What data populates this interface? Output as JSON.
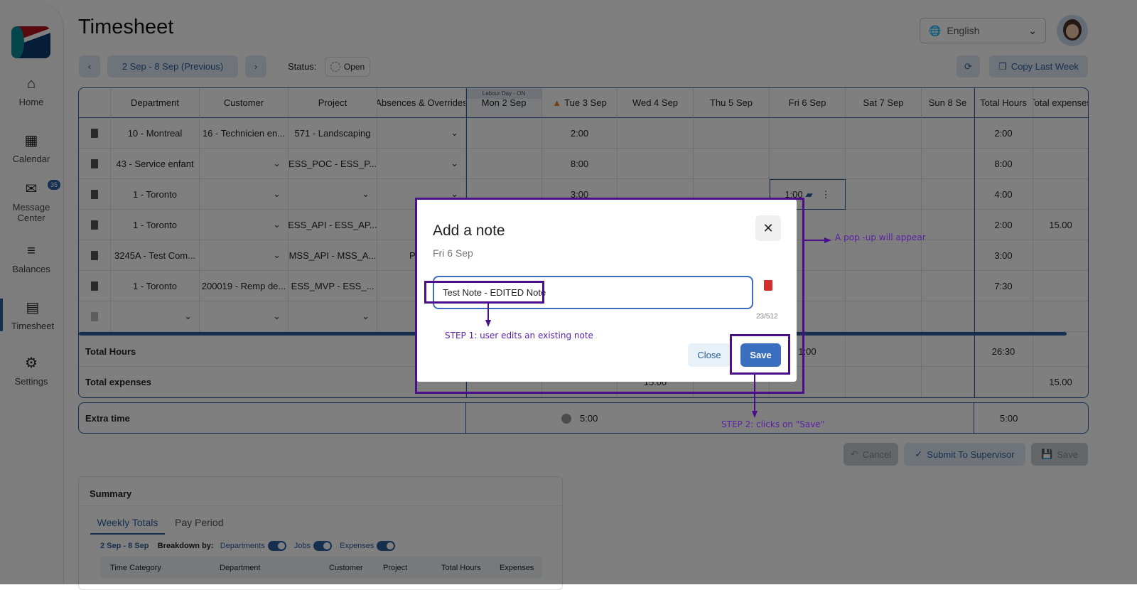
{
  "page_title": "Timesheet",
  "sidebar": {
    "items": [
      {
        "label": "Home",
        "icon": "home-icon",
        "glyph": "⌂"
      },
      {
        "label": "Calendar",
        "icon": "calendar-icon",
        "glyph": "▦"
      },
      {
        "label": "Message Center",
        "icon": "message-icon",
        "glyph": "✉",
        "badge": "35"
      },
      {
        "label": "Balances",
        "icon": "balances-icon",
        "glyph": "≡"
      },
      {
        "label": "Timesheet",
        "icon": "timesheet-icon",
        "glyph": "▤",
        "active": true
      },
      {
        "label": "Settings",
        "icon": "gear-icon",
        "glyph": "⚙"
      }
    ]
  },
  "header": {
    "language": "English",
    "prev_label": "‹",
    "next_label": "›",
    "period": "2 Sep - 8 Sep (Previous)",
    "status_label": "Status:",
    "status_value": "Open",
    "copy_last_week": "Copy Last Week"
  },
  "table": {
    "columns": [
      "",
      "Department",
      "Customer",
      "Project",
      "Absences & Overrides",
      "Mon 2 Sep",
      "Tue 3 Sep",
      "Wed 4 Sep",
      "Thu 5 Sep",
      "Fri 6 Sep",
      "Sat 7 Sep",
      "Sun 8 Se",
      "Total Hours",
      "Total expenses"
    ],
    "holiday_label": "Labour Day - ON",
    "rows": [
      {
        "department": "10 - Montreal",
        "customer": "16 - Technicien en...",
        "project": "571 - Landscaping",
        "absence": "",
        "days": [
          "",
          "2:00",
          "",
          "",
          "",
          "",
          ""
        ],
        "total_hours": "2:00",
        "total_expenses": ""
      },
      {
        "department": "43 - Service enfant",
        "customer": "",
        "project": "ESS_POC - ESS_P...",
        "absence": "",
        "days": [
          "",
          "8:00",
          "",
          "",
          "",
          "",
          ""
        ],
        "total_hours": "8:00",
        "total_expenses": ""
      },
      {
        "department": "1 - Toronto",
        "customer": "",
        "project": "",
        "absence": "",
        "days": [
          "",
          "3:00",
          "",
          "",
          "1:00",
          "",
          ""
        ],
        "total_hours": "4:00",
        "total_expenses": ""
      },
      {
        "department": "1 - Toronto",
        "customer": "",
        "project": "ESS_API - ESS_AP...",
        "absence": "",
        "days": [
          "",
          "",
          "",
          "",
          "",
          "",
          ""
        ],
        "total_hours": "2:00",
        "total_expenses": "15.00"
      },
      {
        "department": "3245A - Test Com...",
        "customer": "",
        "project": "MSS_API - MSS_A...",
        "absence": "Perso",
        "days": [
          "",
          "",
          "",
          "",
          "",
          "",
          ""
        ],
        "total_hours": "3:00",
        "total_expenses": ""
      },
      {
        "department": "1 - Toronto",
        "customer": "200019 - Remp de...",
        "project": "ESS_MVP - ESS_...",
        "absence": "",
        "days": [
          "",
          "",
          "",
          "",
          "",
          "",
          ""
        ],
        "total_hours": "7:30",
        "total_expenses": ""
      },
      {
        "department": "",
        "customer": "",
        "project": "",
        "absence": "",
        "days": [
          "",
          "",
          "",
          "",
          "",
          "",
          ""
        ],
        "total_hours": "",
        "total_expenses": ""
      }
    ],
    "total_hours": {
      "label": "Total Hours",
      "fri": "1:00",
      "total": "26:30"
    },
    "total_expenses": {
      "label": "Total expenses",
      "wed": "15.00",
      "total": "15.00"
    },
    "extra_time": {
      "label": "Extra time",
      "tue": "5:00",
      "total": "5:00"
    }
  },
  "actions": {
    "cancel": "Cancel",
    "submit": "Submit To Supervisor",
    "save": "Save"
  },
  "summary": {
    "title": "Summary",
    "tabs": [
      "Weekly Totals",
      "Pay Period"
    ],
    "range": "2 Sep - 8 Sep",
    "breakdown_label": "Breakdown by:",
    "toggles": [
      "Departments",
      "Jobs",
      "Expenses"
    ],
    "columns": [
      "Time Category",
      "Department",
      "Customer",
      "Project",
      "Total Hours",
      "Expenses"
    ]
  },
  "modal": {
    "title": "Add a note",
    "subtitle": "Fri 6 Sep",
    "note_value": "Test Note - EDITED Note",
    "counter": "23/512",
    "close": "Close",
    "save": "Save"
  },
  "annotations": {
    "popup": "A pop -up will appear",
    "step1": "STEP 1: user edits an existing note",
    "step2": "STEP 2: clicks on \"Save\""
  },
  "colors": {
    "accent": "#2d5f9e",
    "annotation": "#4b0f8c",
    "delete": "#d32f2f",
    "warning": "#e67e22"
  }
}
